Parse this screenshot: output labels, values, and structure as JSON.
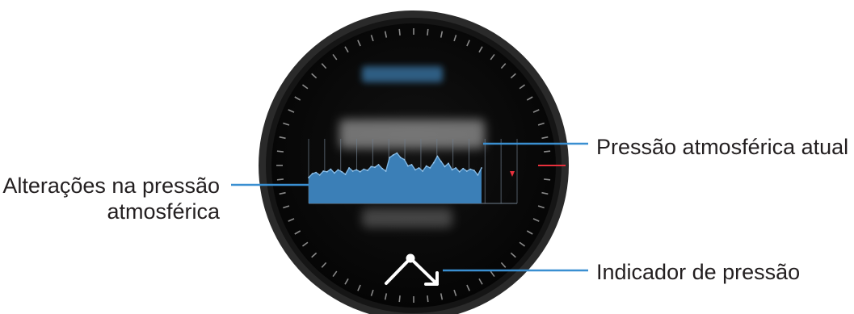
{
  "callouts": {
    "current_pressure": "Pressão atmosférica atual",
    "pressure_changes_line1": "Alterações na pressão",
    "pressure_changes_line2": "atmosférica",
    "pressure_indicator": "Indicador de pressão"
  },
  "icons": {
    "pressure_indicator": "trend-arrow-up-down-icon",
    "marker": "red-triangle-marker-icon"
  },
  "colors": {
    "bezel": "#2b2b2b",
    "face": "#0a0a0a",
    "graph_fill": "#3b7fb7",
    "graph_grid": "#6f7d8c",
    "callout_line": "#3a8fd1",
    "marker": "#e8303c",
    "text": "#231f20"
  },
  "chart_data": {
    "type": "area",
    "values": [
      40,
      46,
      48,
      44,
      50,
      49,
      53,
      47,
      52,
      49,
      45,
      55,
      50,
      52,
      49,
      53,
      51,
      57,
      56,
      60,
      54,
      50,
      71,
      75,
      78,
      71,
      68,
      58,
      60,
      52,
      55,
      50,
      58,
      55,
      63,
      73,
      65,
      57,
      62,
      52,
      55,
      49,
      54,
      50,
      53,
      51,
      44,
      55
    ],
    "ylim": [
      0,
      100
    ]
  }
}
